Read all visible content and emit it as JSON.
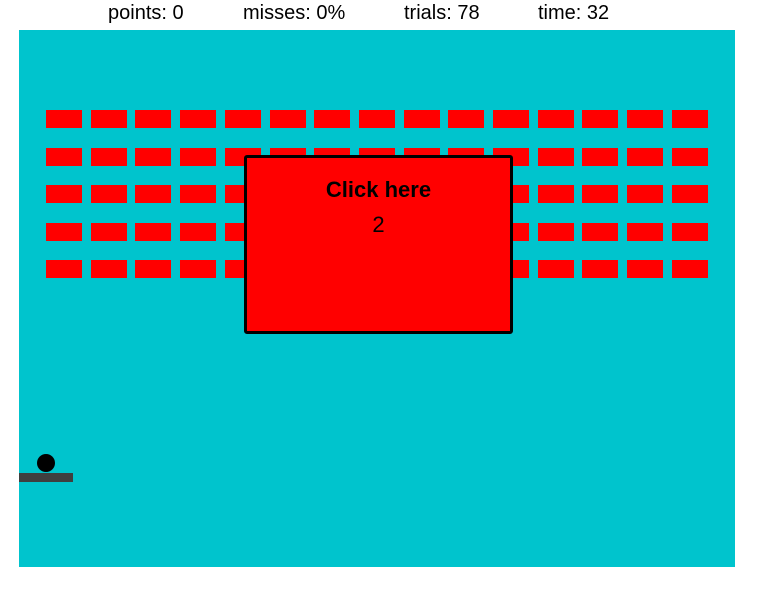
{
  "hud": {
    "points": "points: 0",
    "misses": "misses: 0%",
    "trials": "trials: 78",
    "time": "time: 32"
  },
  "game": {
    "background_color": "#00c4cd",
    "brick_color": "#ff0000",
    "brick_rows": 5,
    "brick_cols": 15,
    "dialog": {
      "title": "Click here",
      "count": "2"
    }
  }
}
